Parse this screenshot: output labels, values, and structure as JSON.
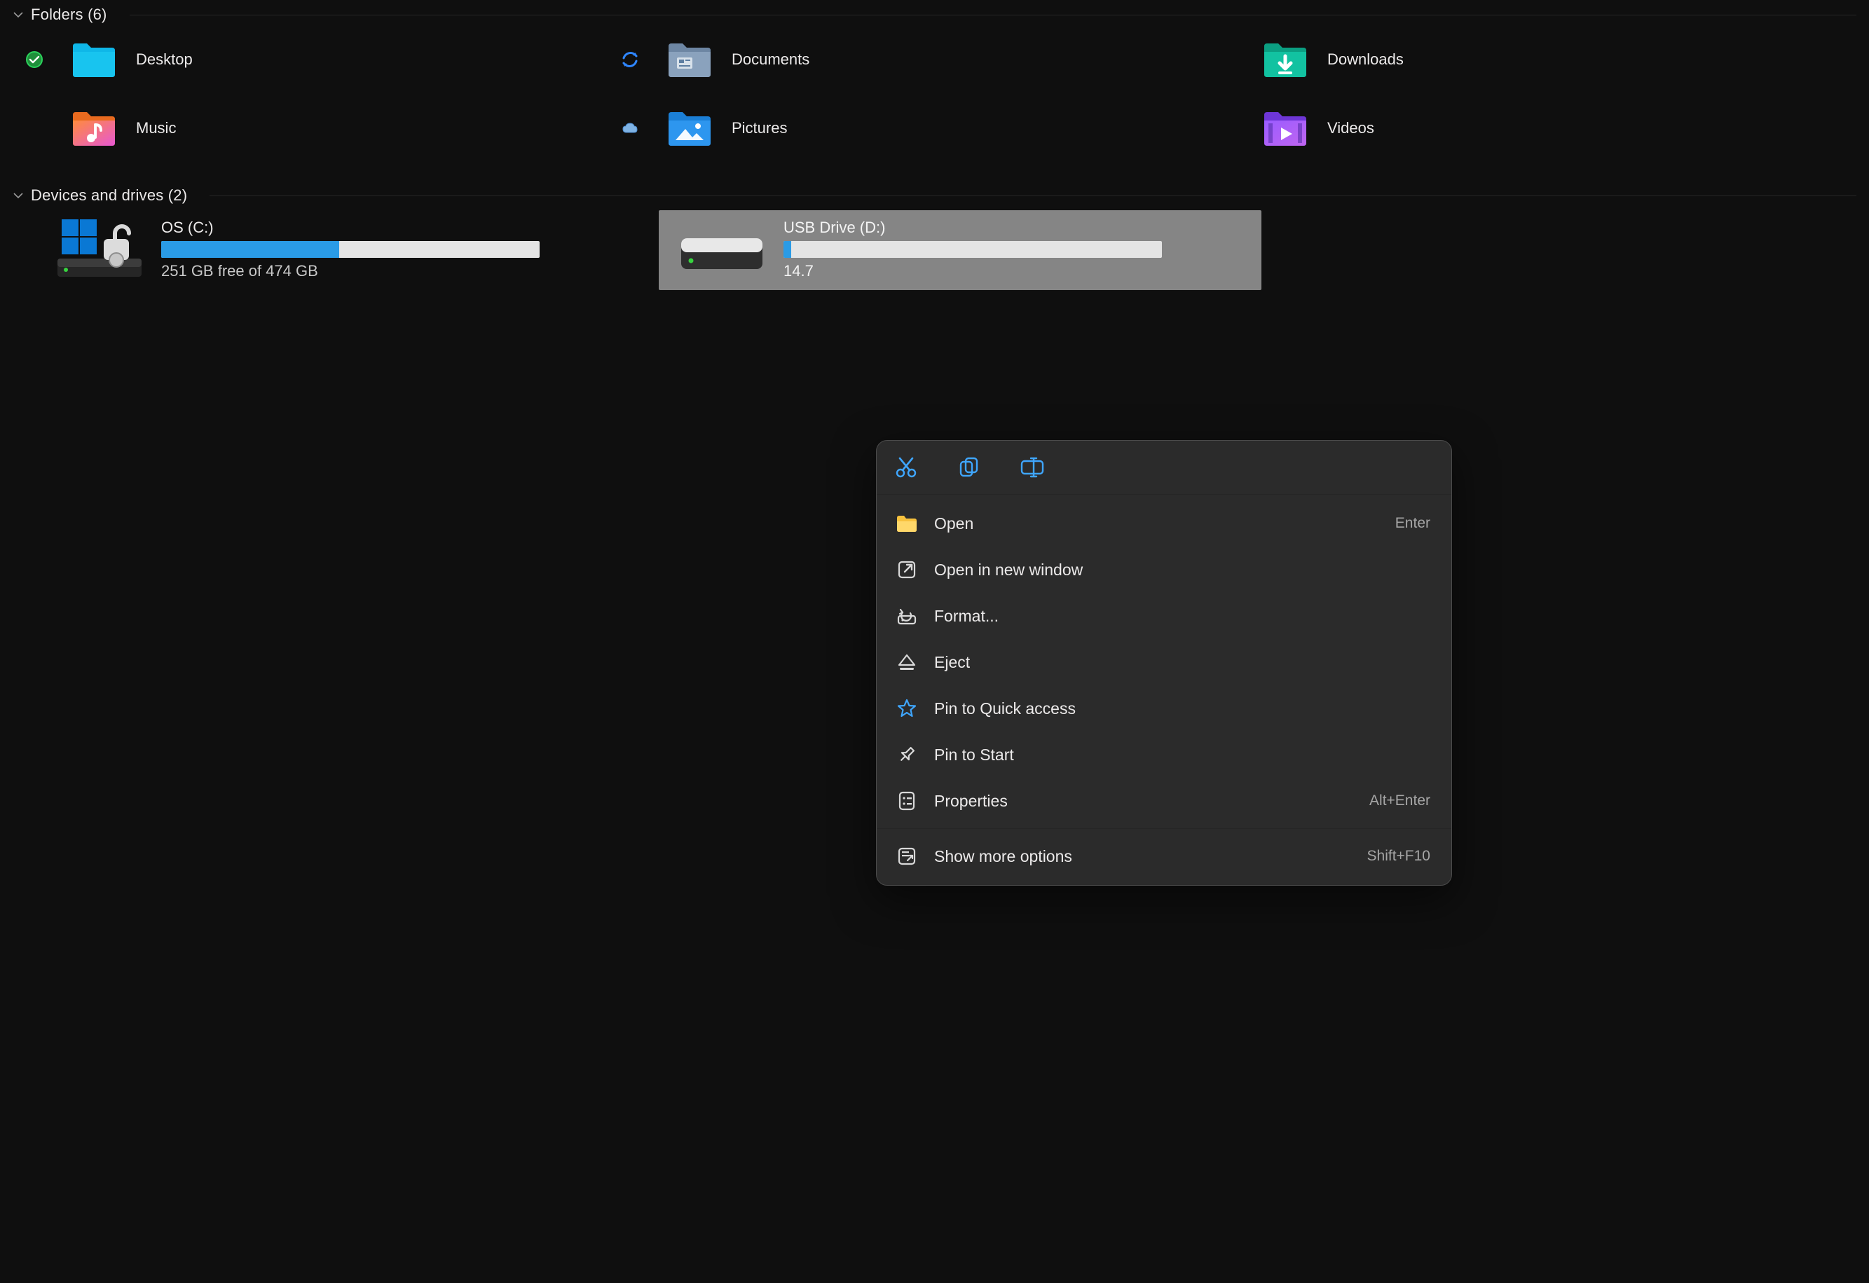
{
  "sections": {
    "folders": {
      "title": "Folders (6)"
    },
    "drives": {
      "title": "Devices and drives (2)"
    }
  },
  "folders": [
    {
      "name": "Desktop",
      "icon": "folder-desktop",
      "status": "synced"
    },
    {
      "name": "Documents",
      "icon": "folder-documents",
      "status": "refresh"
    },
    {
      "name": "Downloads",
      "icon": "folder-downloads",
      "status": null
    },
    {
      "name": "Music",
      "icon": "folder-music",
      "status": null
    },
    {
      "name": "Pictures",
      "icon": "folder-pictures",
      "status": "cloud"
    },
    {
      "name": "Videos",
      "icon": "folder-videos",
      "status": null
    }
  ],
  "drives": [
    {
      "name": "OS (C:)",
      "icon": "drive-os",
      "sub": "251 GB free of 474 GB",
      "fill_percent": 47,
      "selected": false
    },
    {
      "name": "USB Drive (D:)",
      "icon": "drive-usb",
      "sub": "14.7",
      "fill_percent": 2,
      "selected": true
    }
  ],
  "context_menu": {
    "toolbar_icons": [
      {
        "name": "cut-icon"
      },
      {
        "name": "copy-icon"
      },
      {
        "name": "rename-icon"
      }
    ],
    "items": [
      {
        "icon": "open-folder-icon",
        "label": "Open",
        "shortcut": "Enter"
      },
      {
        "icon": "open-window-icon",
        "label": "Open in new window",
        "shortcut": ""
      },
      {
        "icon": "format-icon",
        "label": "Format...",
        "shortcut": ""
      },
      {
        "icon": "eject-icon",
        "label": "Eject",
        "shortcut": ""
      },
      {
        "icon": "pin-star-icon",
        "label": "Pin to Quick access",
        "shortcut": ""
      },
      {
        "icon": "pin-icon",
        "label": "Pin to Start",
        "shortcut": ""
      },
      {
        "icon": "properties-icon",
        "label": "Properties",
        "shortcut": "Alt+Enter"
      },
      {
        "separator": true
      },
      {
        "icon": "more-options-icon",
        "label": "Show more options",
        "shortcut": "Shift+F10"
      }
    ]
  }
}
